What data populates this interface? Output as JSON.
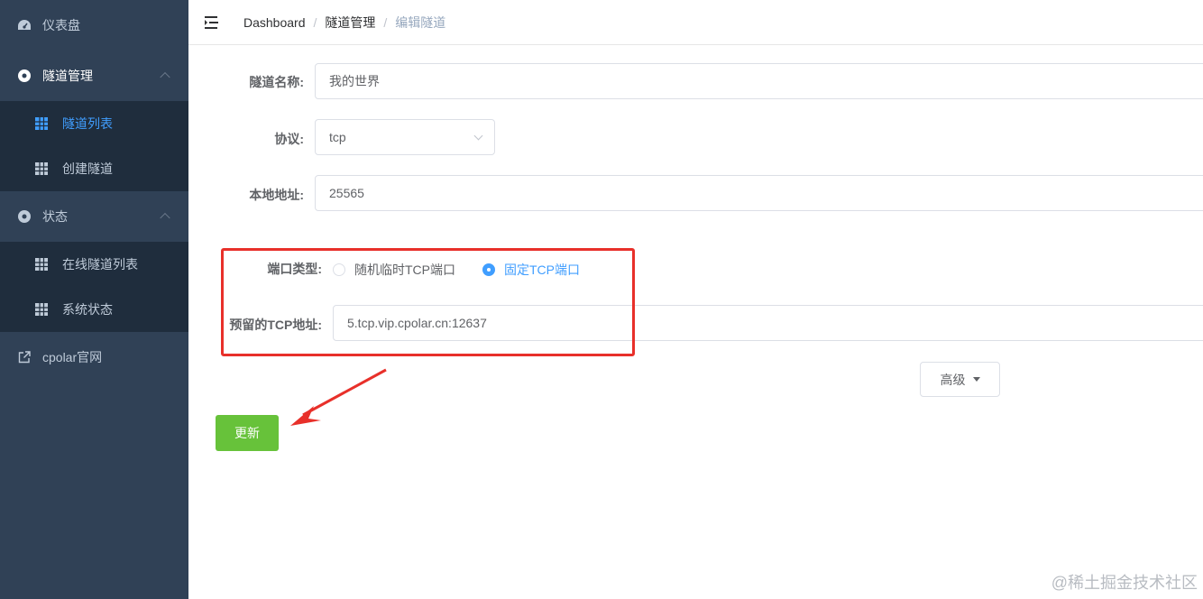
{
  "sidebar": {
    "items": [
      {
        "label": "仪表盘",
        "icon": "dashboard-icon"
      },
      {
        "label": "隧道管理",
        "icon": "tunnel-manage-icon"
      },
      {
        "label": "隧道列表",
        "icon": "grid-icon"
      },
      {
        "label": "创建隧道",
        "icon": "grid-icon"
      },
      {
        "label": "状态",
        "icon": "status-icon"
      },
      {
        "label": "在线隧道列表",
        "icon": "grid-icon"
      },
      {
        "label": "系统状态",
        "icon": "grid-icon"
      },
      {
        "label": "cpolar官网",
        "icon": "external-link-icon"
      }
    ]
  },
  "header": {
    "breadcrumb": [
      "Dashboard",
      "隧道管理",
      "编辑隧道"
    ]
  },
  "form": {
    "tunnel_name": {
      "label": "隧道名称:",
      "value": "我的世界"
    },
    "protocol": {
      "label": "协议:",
      "value": "tcp"
    },
    "local_address": {
      "label": "本地地址:",
      "value": "25565"
    },
    "port_type": {
      "label": "端口类型:",
      "options": [
        "随机临时TCP端口",
        "固定TCP端口"
      ],
      "selected": "固定TCP端口"
    },
    "reserved_tcp": {
      "label": "预留的TCP地址:",
      "value": "5.tcp.vip.cpolar.cn:12637"
    },
    "advanced_label": "高级",
    "update_label": "更新"
  },
  "watermark": "@稀土掘金技术社区",
  "colors": {
    "sidebar_bg": "#304156",
    "submenu_bg": "#1f2d3d",
    "active": "#409eff",
    "update_button": "#67c23a",
    "annotation": "#e8302a"
  }
}
